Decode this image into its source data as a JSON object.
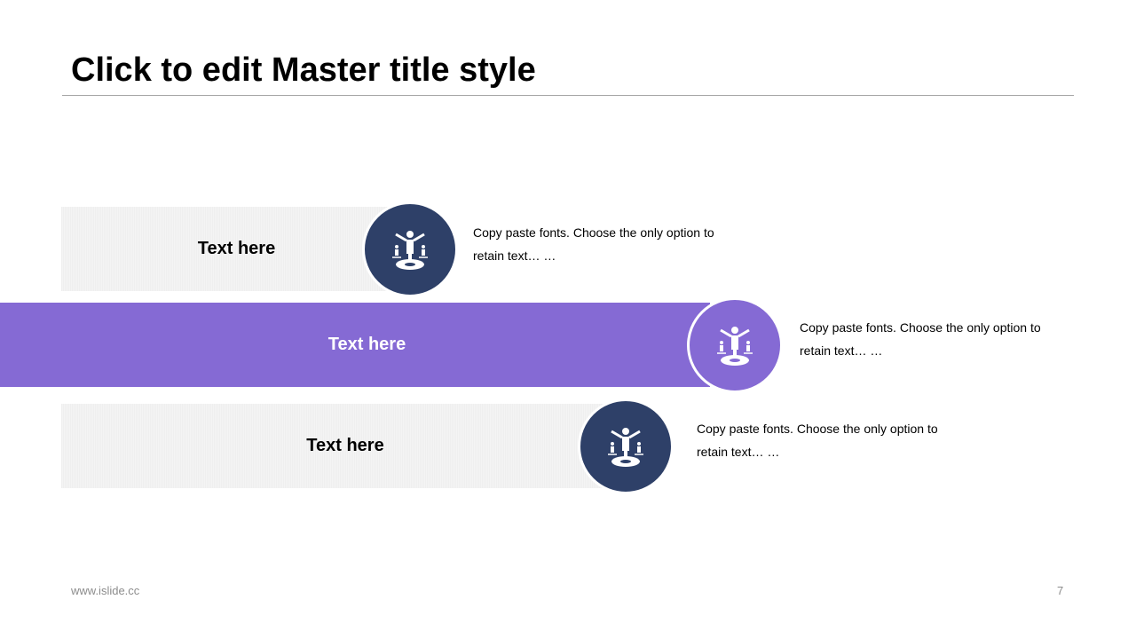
{
  "title": "Click to edit Master title style",
  "rows": [
    {
      "label": "Text here",
      "description": "Copy paste fonts. Choose the only option to retain text… …",
      "accent": "#2e4068"
    },
    {
      "label": "Text here",
      "description": "Copy paste fonts. Choose the only option to retain text… …",
      "accent": "#856ad4"
    },
    {
      "label": "Text here",
      "description": "Copy paste fonts. Choose the only option to retain text… …",
      "accent": "#2e4068"
    }
  ],
  "icon": "person-balancing-scales-icon",
  "footer": {
    "url": "www.islide.cc",
    "page": "7"
  }
}
